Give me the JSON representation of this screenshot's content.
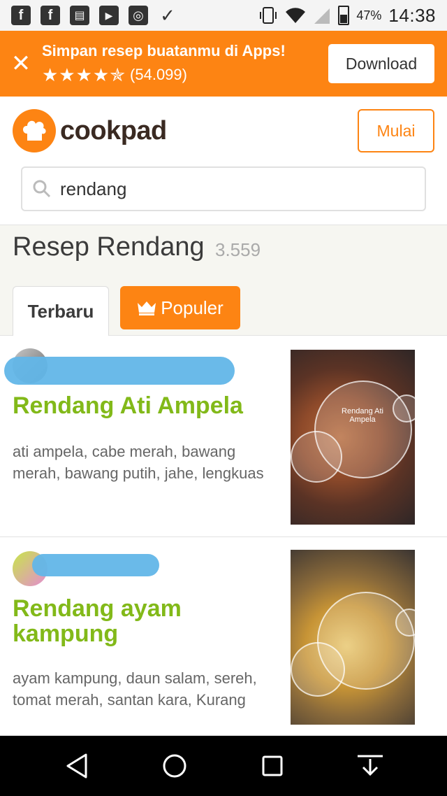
{
  "status_bar": {
    "notification_icons": [
      "facebook-icon",
      "facebook-icon",
      "clipboard-icon",
      "youtube-icon",
      "instagram-icon",
      "check-icon"
    ],
    "battery": "47%",
    "time": "14:38"
  },
  "app_banner": {
    "title": "Simpan resep buatanmu di Apps!",
    "stars": "★★★★✯",
    "rating_count": "(54.099)",
    "download_label": "Download"
  },
  "header": {
    "logo_text": "cookpad",
    "start_label": "Mulai",
    "search_value": "rendang"
  },
  "results": {
    "title": "Resep Rendang",
    "count": "3.559",
    "tabs": [
      {
        "label": "Terbaru",
        "active": true
      },
      {
        "label": "Populer",
        "active": false
      }
    ]
  },
  "recipes": [
    {
      "title": "Rendang Ati Ampela",
      "ingredients": "ati ampela, cabe merah, bawang merah, bawang putih, jahe, lengkuas",
      "photo_caption": "Rendang Ati Ampela"
    },
    {
      "title": "Rendang ayam kampung",
      "ingredients": "ayam kampung, daun salam, sereh, tomat merah, santan kara, Kurang"
    }
  ],
  "colors": {
    "brand_orange": "#fd8413",
    "title_green": "#82b919",
    "redaction_blue": "#62b6e8"
  }
}
